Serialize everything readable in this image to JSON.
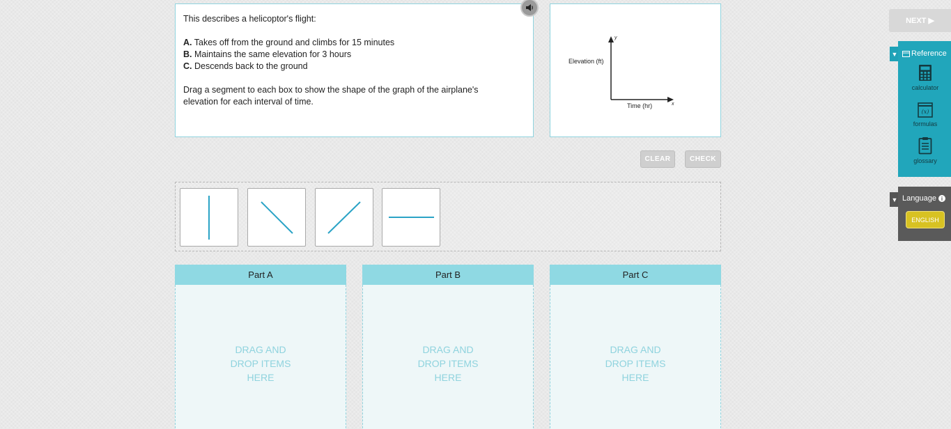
{
  "question": {
    "intro": "This describes a helicoptor's flight:",
    "items": [
      {
        "letter": "A.",
        "text": "Takes off from the ground and climbs for 15 minutes"
      },
      {
        "letter": "B.",
        "text": "Maintains the same elevation for 3 hours"
      },
      {
        "letter": "C.",
        "text": "Descends back to the ground"
      }
    ],
    "instruction_line1": "Drag a segment to each box to show the shape of the graph of the airplane's",
    "instruction_line2": "elevation for each interval of time."
  },
  "graph": {
    "ylabel": "Elevation (ft)",
    "xlabel": "Time (hr)",
    "y_axis_letter": "y",
    "x_axis_letter": "x"
  },
  "buttons": {
    "clear": "CLEAR",
    "check": "CHECK",
    "next": "NEXT ▶"
  },
  "segments": [
    "vertical-segment",
    "decreasing-segment",
    "increasing-segment",
    "horizontal-segment"
  ],
  "parts": [
    {
      "title": "Part A",
      "drop_text": "DRAG AND DROP ITEMS HERE"
    },
    {
      "title": "Part B",
      "drop_text": "DRAG AND DROP ITEMS HERE"
    },
    {
      "title": "Part C",
      "drop_text": "DRAG AND DROP ITEMS HERE"
    }
  ],
  "reference": {
    "title": "Reference",
    "tools": [
      {
        "label": "calculator",
        "icon": "calculator-icon"
      },
      {
        "label": "formulas",
        "icon": "formulas-icon"
      },
      {
        "label": "glossary",
        "icon": "clipboard-icon"
      }
    ]
  },
  "language": {
    "title": "Language",
    "selected": "ENGLISH"
  },
  "colors": {
    "accent": "#21a6bb",
    "segment": "#2aa3c6",
    "drop_header": "#8fd9e3",
    "english": "#d8c222"
  }
}
